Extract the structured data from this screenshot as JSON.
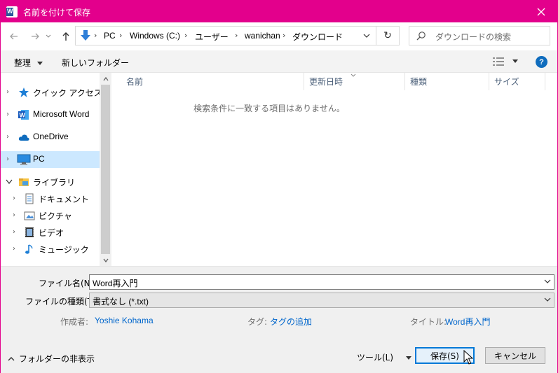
{
  "window": {
    "title": "名前を付けて保存",
    "accent": "#e3008c"
  },
  "address": {
    "crumbs": [
      "PC",
      "Windows (C:)",
      "ユーザー",
      "wanichan",
      "ダウンロード"
    ]
  },
  "search": {
    "placeholder": "ダウンロードの検索"
  },
  "toolbar": {
    "organize": "整理",
    "new_folder": "新しいフォルダー",
    "help": "?"
  },
  "nav": {
    "items": [
      {
        "label": "クイック アクセス",
        "icon": "star-icon"
      },
      {
        "label": "Microsoft Word",
        "icon": "word-icon"
      },
      {
        "label": "OneDrive",
        "icon": "cloud-icon"
      },
      {
        "label": "PC",
        "icon": "pc-icon",
        "selected": true
      },
      {
        "label": "ライブラリ",
        "icon": "library-icon"
      },
      {
        "label": "ドキュメント",
        "icon": "document-icon"
      },
      {
        "label": "ピクチャ",
        "icon": "picture-icon"
      },
      {
        "label": "ビデオ",
        "icon": "video-icon"
      },
      {
        "label": "ミュージック",
        "icon": "music-icon"
      }
    ]
  },
  "filelist": {
    "columns": [
      "名前",
      "更新日時",
      "種類",
      "サイズ"
    ],
    "empty_message": "検索条件に一致する項目はありません。"
  },
  "form": {
    "filename_label": "ファイル名(N):",
    "filename_value": "Word再入門",
    "filetype_label": "ファイルの種類(T):",
    "filetype_value": "書式なし (*.txt)",
    "author_label": "作成者:",
    "author_value": "Yoshie Kohama",
    "tags_label": "タグ:",
    "tags_value": "タグの追加",
    "title_label": "タイトル:",
    "title_value": "Word再入門"
  },
  "footer": {
    "hide_folders": "フォルダーの非表示",
    "tools": "ツール(L)",
    "save": "保存(S)",
    "cancel": "キャンセル"
  }
}
